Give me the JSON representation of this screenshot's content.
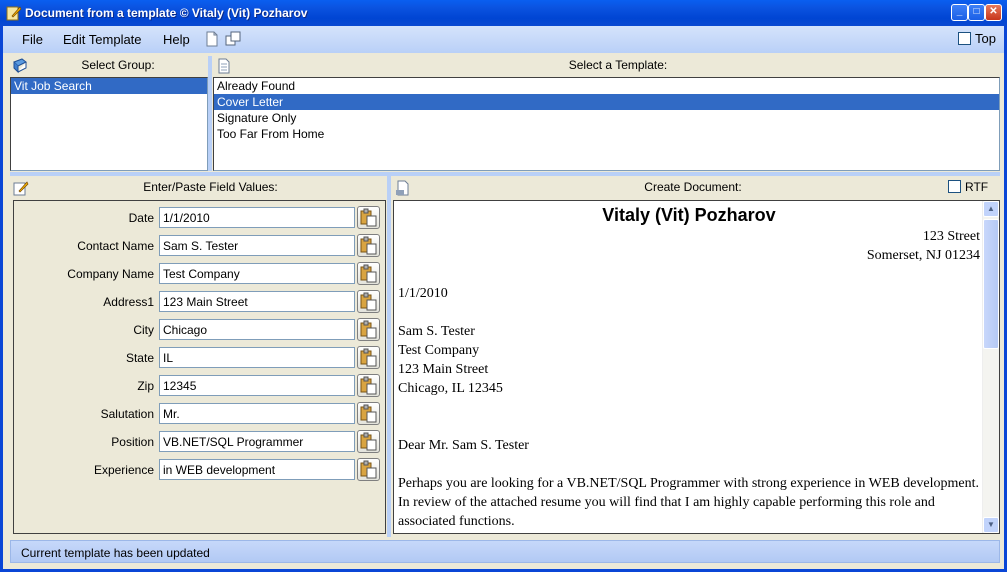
{
  "window": {
    "title": "Document from a template © Vitaly (Vit) Pozharov",
    "min_label": "_",
    "max_label": "□",
    "close_label": "✕"
  },
  "menu": {
    "file": "File",
    "edit_template": "Edit Template",
    "help": "Help",
    "top_label": "Top",
    "top_checked": false
  },
  "groups": {
    "header": "Select Group:",
    "items": [
      "Vit Job Search"
    ],
    "selected_index": 0
  },
  "templates": {
    "header": "Select a Template:",
    "items": [
      "Already Found",
      "Cover Letter",
      "Signature Only",
      "Too Far From Home"
    ],
    "selected_index": 1
  },
  "fields": {
    "header": "Enter/Paste Field Values:",
    "rows": [
      {
        "label": "Date",
        "value": "1/1/2010"
      },
      {
        "label": "Contact Name",
        "value": "Sam S. Tester"
      },
      {
        "label": "Company Name",
        "value": "Test Company"
      },
      {
        "label": "Address1",
        "value": "123 Main Street"
      },
      {
        "label": "City",
        "value": "Chicago"
      },
      {
        "label": "State",
        "value": "IL"
      },
      {
        "label": "Zip",
        "value": "12345"
      },
      {
        "label": "Salutation",
        "value": "Mr."
      },
      {
        "label": "Position",
        "value": "VB.NET/SQL Programmer"
      },
      {
        "label": "Experience",
        "value": "in WEB development"
      }
    ]
  },
  "document": {
    "header": "Create Document:",
    "rtf_label": "RTF",
    "rtf_checked": false,
    "name": "Vitaly (Vit) Pozharov",
    "address1": "123 Street",
    "address2": "Somerset, NJ 01234",
    "date": "1/1/2010",
    "recipient": [
      "Sam S. Tester",
      "Test Company",
      "123 Main Street",
      "Chicago, IL 12345"
    ],
    "greeting": "Dear Mr. Sam S. Tester",
    "body1": "Perhaps you are looking for a VB.NET/SQL Programmer with strong experience in WEB development.  In review of the attached resume you will find that I am highly capable performing this role and associated functions."
  },
  "status": {
    "text": "Current template has been updated"
  },
  "colors": {
    "selection": "#316ac5",
    "titlebar": "#0a5ff0",
    "menubar": "#c6d8fa"
  }
}
